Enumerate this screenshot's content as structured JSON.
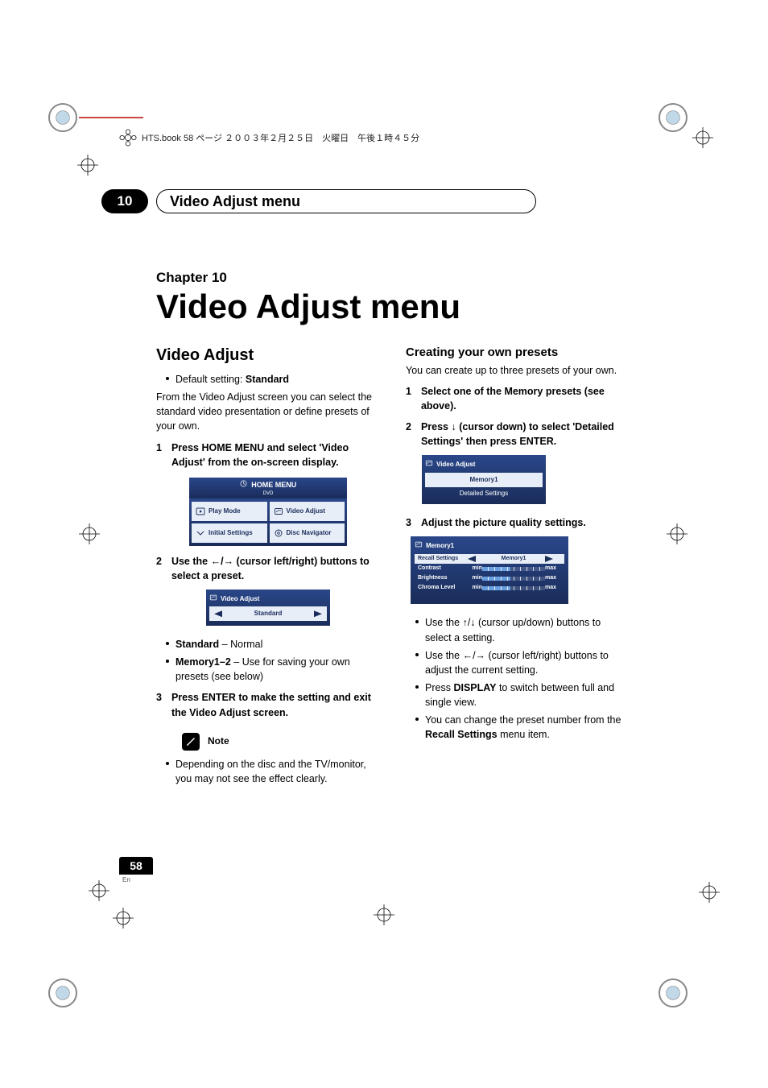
{
  "header_line": "HTS.book  58 ページ  ２００３年２月２５日　火曜日　午後１時４５分",
  "chapter_bar": {
    "number": "10",
    "title": "Video Adjust menu"
  },
  "chapter_label": "Chapter 10",
  "main_title": "Video Adjust menu",
  "left": {
    "h2": "Video Adjust",
    "default_prefix": "Default setting: ",
    "default_value": "Standard",
    "intro": "From the Video Adjust screen you can select the standard video presentation or define presets of your own.",
    "step1_num": "1",
    "step1": "Press HOME MENU and select 'Video Adjust' from the on-screen display.",
    "home_menu": {
      "title": "HOME MENU",
      "sub": "DVD",
      "cells": [
        "Play Mode",
        "Video Adjust",
        "Initial Settings",
        "Disc Navigator"
      ]
    },
    "step2_num": "2",
    "step2_pre": "Use the ",
    "step2_post": " (cursor left/right) buttons to select a preset.",
    "va_box": {
      "head": "Video Adjust",
      "value": "Standard"
    },
    "opt_standard": "Standard",
    "opt_standard_desc": " – Normal",
    "opt_memory": "Memory1–2",
    "opt_memory_desc": " – Use for saving your own presets (see below)",
    "step3_num": "3",
    "step3": "Press ENTER to make the setting and exit the Video Adjust screen.",
    "note_label": "Note",
    "note_text": "Depending on the disc and the TV/monitor, you may not see the effect clearly."
  },
  "right": {
    "h3": "Creating your own presets",
    "intro": "You can create up to three presets of your own.",
    "step1_num": "1",
    "step1": "Select one of the Memory presets (see above).",
    "step2_num": "2",
    "step2_pre": "Press ",
    "step2_post": " (cursor down) to select 'Detailed Settings' then press ENTER.",
    "va_box": {
      "head": "Video Adjust",
      "val": "Memory1",
      "ds": "Detailed Settings"
    },
    "step3_num": "3",
    "step3": "Adjust the picture quality settings.",
    "mem_box": {
      "head": "Memory1",
      "rows": [
        {
          "label": "Recall Settings",
          "val": "Memory1",
          "type": "sel"
        },
        {
          "label": "Contrast",
          "min": "min",
          "max": "max",
          "type": "gauge"
        },
        {
          "label": "Brightness",
          "min": "min",
          "max": "max",
          "type": "gauge"
        },
        {
          "label": "Chroma Level",
          "min": "min",
          "max": "max",
          "type": "gauge"
        }
      ]
    },
    "b1_pre": "Use the ",
    "b1_post": " (cursor up/down) buttons to select a setting.",
    "b2_pre": "Use the ",
    "b2_post": " (cursor left/right) buttons to adjust the current setting.",
    "b3_pre": "Press ",
    "b3_bold": "DISPLAY",
    "b3_post": " to switch between full and single view.",
    "b4_pre": "You can change the preset number from the ",
    "b4_bold": "Recall Settings",
    "b4_post": " menu item."
  },
  "page": {
    "num": "58",
    "lang": "En"
  }
}
